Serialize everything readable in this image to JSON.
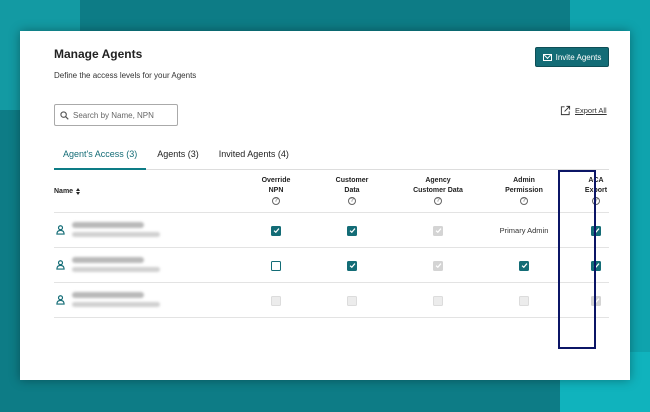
{
  "page": {
    "title": "Manage Agents",
    "subtitle": "Define the access levels for your Agents",
    "invite_button": "Invite Agents",
    "search_placeholder": "Search by Name, NPN",
    "export_label": "Export All"
  },
  "tabs": [
    {
      "label": "Agent's Access (3)",
      "active": true
    },
    {
      "label": "Agents (3)",
      "active": false
    },
    {
      "label": "Invited Agents (4)",
      "active": false
    }
  ],
  "table": {
    "name_header": "Name",
    "columns": [
      {
        "line1": "Override",
        "line2": "NPN"
      },
      {
        "line1": "Customer",
        "line2": "Data"
      },
      {
        "line1": "Agency",
        "line2": "Customer Data"
      },
      {
        "line1": "Admin",
        "line2": "Permission"
      },
      {
        "line1": "ACA",
        "line2": "Export"
      }
    ],
    "rows": [
      {
        "cells": [
          "on",
          "on",
          "dis-on",
          "text",
          "on"
        ],
        "admin_text": "Primary Admin"
      },
      {
        "cells": [
          "off",
          "on",
          "dis-on",
          "on",
          "on"
        ]
      },
      {
        "cells": [
          "dis-off",
          "dis-off",
          "dis-off",
          "dis-off",
          "dis-on"
        ]
      }
    ]
  },
  "colors": {
    "accent": "#136c76",
    "background": "#0d7c86",
    "highlight_border": "#0b1566"
  }
}
